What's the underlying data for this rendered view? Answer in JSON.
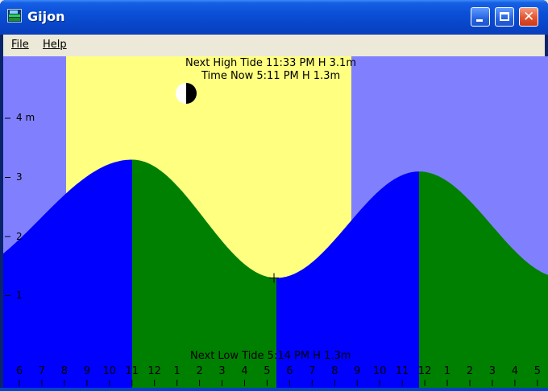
{
  "window": {
    "title": "Gijon"
  },
  "menu": {
    "file": "File",
    "help": "Help"
  },
  "tide": {
    "next_high": "Next High Tide 11:33 PM H 3.1m",
    "time_now": "Time Now 5:11 PM H 1.3m",
    "next_low": "Next Low Tide 5:14 PM H 1.3m"
  },
  "colors": {
    "night": "#8080ff",
    "day": "#ffff80",
    "rising": "#0000ff",
    "falling": "#008000"
  },
  "icons": {
    "moon": "half-moon-icon",
    "app": "tide-app-icon",
    "cursor": "crosshair-icon"
  },
  "chart_data": {
    "type": "area",
    "y_unit": "m",
    "y_tick_labels": [
      "1",
      "2",
      "3",
      "4 m"
    ],
    "x_tick_labels": [
      "6",
      "7",
      "8",
      "9",
      "10",
      "11",
      "12",
      "1",
      "2",
      "3",
      "4",
      "5",
      "6",
      "7",
      "8",
      "9",
      "10",
      "11",
      "12",
      "1",
      "2",
      "3",
      "4",
      "5"
    ],
    "daylight_hours": [
      "8",
      "9"
    ],
    "high_tides": [
      {
        "hour": "11",
        "height": 3.3
      },
      {
        "hour": "11",
        "height": 3.1
      }
    ],
    "low_tide": {
      "hour": "5",
      "height": 1.3
    }
  }
}
